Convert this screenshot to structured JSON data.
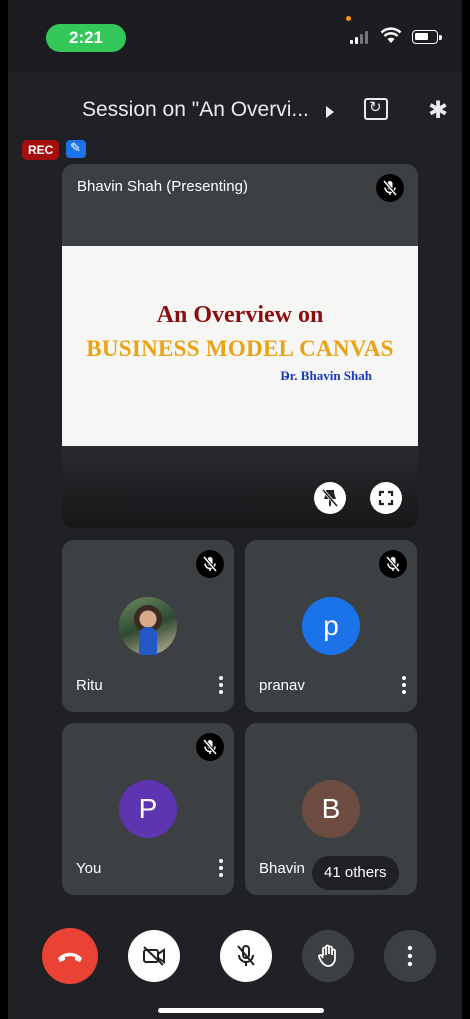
{
  "status_bar": {
    "time": "2:21"
  },
  "header": {
    "session_title": "Session on \"An Overvi..."
  },
  "badges": {
    "rec": "REC"
  },
  "presentation": {
    "presenter_label": "Bhavin Shah (Presenting)",
    "slide_title": "An Overview on",
    "slide_subtitle": "BUSINESS MODEL CANVAS",
    "slide_dash": "-",
    "slide_author": "Dr. Bhavin Shah"
  },
  "participants": [
    {
      "name": "Ritu",
      "avatar": "",
      "avatar_color": ""
    },
    {
      "name": "pranav",
      "avatar": "p",
      "avatar_color": "#1a73e8"
    },
    {
      "name": "You",
      "avatar": "P",
      "avatar_color": "#5e35b1"
    },
    {
      "name": "Bhavin",
      "avatar": "B",
      "avatar_color": "#6d4c41"
    }
  ],
  "others_label": "41 others",
  "controls": [
    "end-call",
    "camera-off",
    "mic-off",
    "raise-hand",
    "more-options"
  ],
  "colors": {
    "end_call": "#ea4335",
    "time_pill": "#34c759",
    "rec": "#a50e0e"
  }
}
